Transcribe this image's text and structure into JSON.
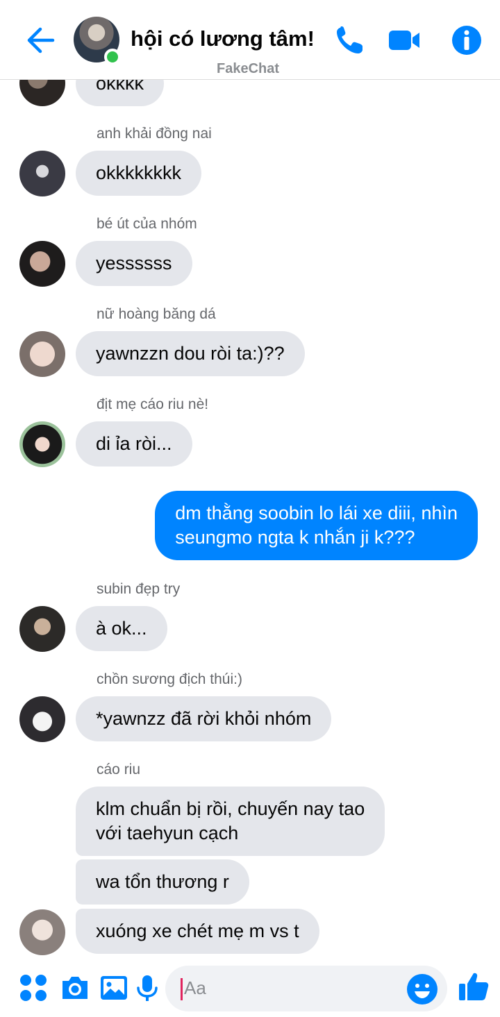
{
  "header": {
    "title": "hội có lương tâm!",
    "watermark": "FakeChat",
    "accent_color": "#0084ff",
    "online_color": "#31c24d",
    "icons": [
      "back-arrow-icon",
      "phone-icon",
      "video-camera-icon",
      "info-icon"
    ]
  },
  "messages": [
    {
      "text": "okkkk",
      "avatar": "avatar-1"
    },
    {
      "sender": "anh khải đồng nai",
      "text": "okkkkkkkk",
      "avatar": "avatar-2"
    },
    {
      "sender": "bé út của nhóm",
      "text": "yessssss",
      "avatar": "avatar-3"
    },
    {
      "sender": "nữ hoàng băng dá",
      "text": "yawnzzn dou ròi ta:)??",
      "avatar": "avatar-4"
    },
    {
      "sender": "địt mẹ cáo riu nè!",
      "text": "di ỉa ròi...",
      "avatar": "avatar-5"
    },
    {
      "mine": true,
      "line1": "dm thằng soobin lo lái xe diii, nhìn",
      "line2": "seungmo ngta k nhắn ji k???"
    },
    {
      "sender": "subin đẹp try",
      "text": "à ok...",
      "avatar": "avatar-6"
    },
    {
      "sender": "chồn sương địch thúi:)",
      "text": "*yawnzz đã rời khỏi nhóm",
      "avatar": "avatar-7"
    },
    {
      "sender": "cáo riu",
      "line1": "klm chuẩn bị rồi, chuyến nay tao",
      "line2": "với taehyun cạch"
    },
    {
      "text": "wa tổn thương r"
    },
    {
      "text": "xuóng xe chét mẹ m vs t",
      "avatar": "avatar-8"
    }
  ],
  "composer": {
    "placeholder": "Aa",
    "icons": [
      "apps-icon",
      "camera-icon",
      "gallery-icon",
      "mic-icon",
      "emoji-icon",
      "like-icon"
    ]
  }
}
